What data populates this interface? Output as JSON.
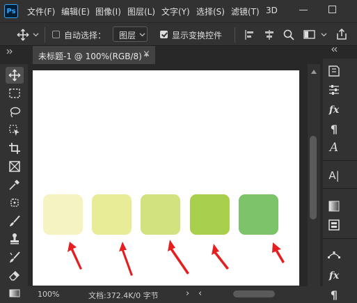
{
  "app": {
    "logo": "Ps"
  },
  "menu": [
    "文件(F)",
    "编辑(E)",
    "图像(I)",
    "图层(L)",
    "文字(Y)",
    "选择(S)",
    "滤镜(T)",
    "3D"
  ],
  "options": {
    "auto_select_label": "自动选择：",
    "auto_select_checked": false,
    "layer_select_value": "图层",
    "show_transform_label": "显示变换控件",
    "show_transform_checked": true
  },
  "document": {
    "tab_title": "未标题-1 @ 100%(RGB/8) *",
    "close_glyph": "×"
  },
  "swatches": [
    "#f6f3c2",
    "#e9ec97",
    "#d2e27f",
    "#a9d04d",
    "#7cc36a"
  ],
  "annotation_color": "#e51f1f",
  "status": {
    "zoom": "100%",
    "doc_info": "文档:372.4K/0 字节",
    "expand_glyph": "›",
    "scroll_left_glyph": "‹",
    "scroll_right_glyph": "›"
  }
}
